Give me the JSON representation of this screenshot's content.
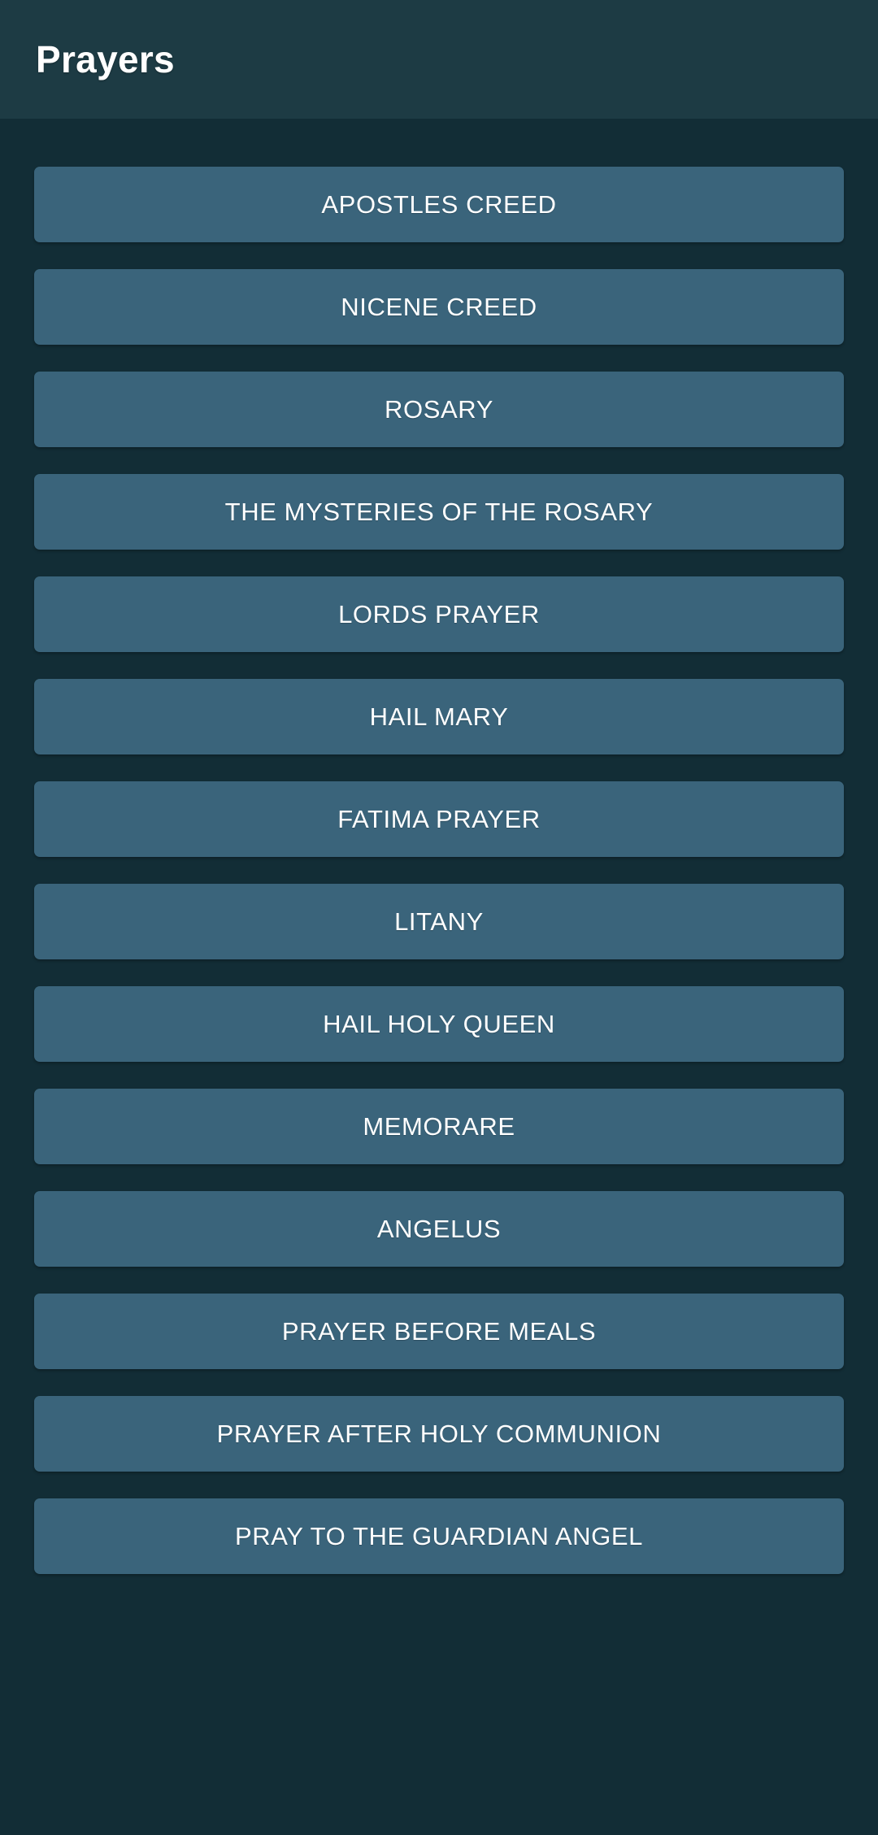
{
  "app": {
    "title": "Prayers",
    "header_background": "#1d3b44",
    "body_background": "#122d36",
    "button_background": "#3a647b",
    "text_color": "#ffffff"
  },
  "prayer_list": {
    "items": [
      {
        "label": "APOSTLES CREED"
      },
      {
        "label": "NICENE CREED"
      },
      {
        "label": "ROSARY"
      },
      {
        "label": "THE MYSTERIES OF THE ROSARY"
      },
      {
        "label": "LORDS PRAYER"
      },
      {
        "label": "HAIL MARY"
      },
      {
        "label": "FATIMA PRAYER"
      },
      {
        "label": "LITANY"
      },
      {
        "label": "HAIL HOLY QUEEN"
      },
      {
        "label": "MEMORARE"
      },
      {
        "label": "ANGELUS"
      },
      {
        "label": "PRAYER BEFORE MEALS"
      },
      {
        "label": "PRAYER AFTER HOLY COMMUNION"
      },
      {
        "label": "PRAY TO THE GUARDIAN ANGEL"
      }
    ]
  }
}
